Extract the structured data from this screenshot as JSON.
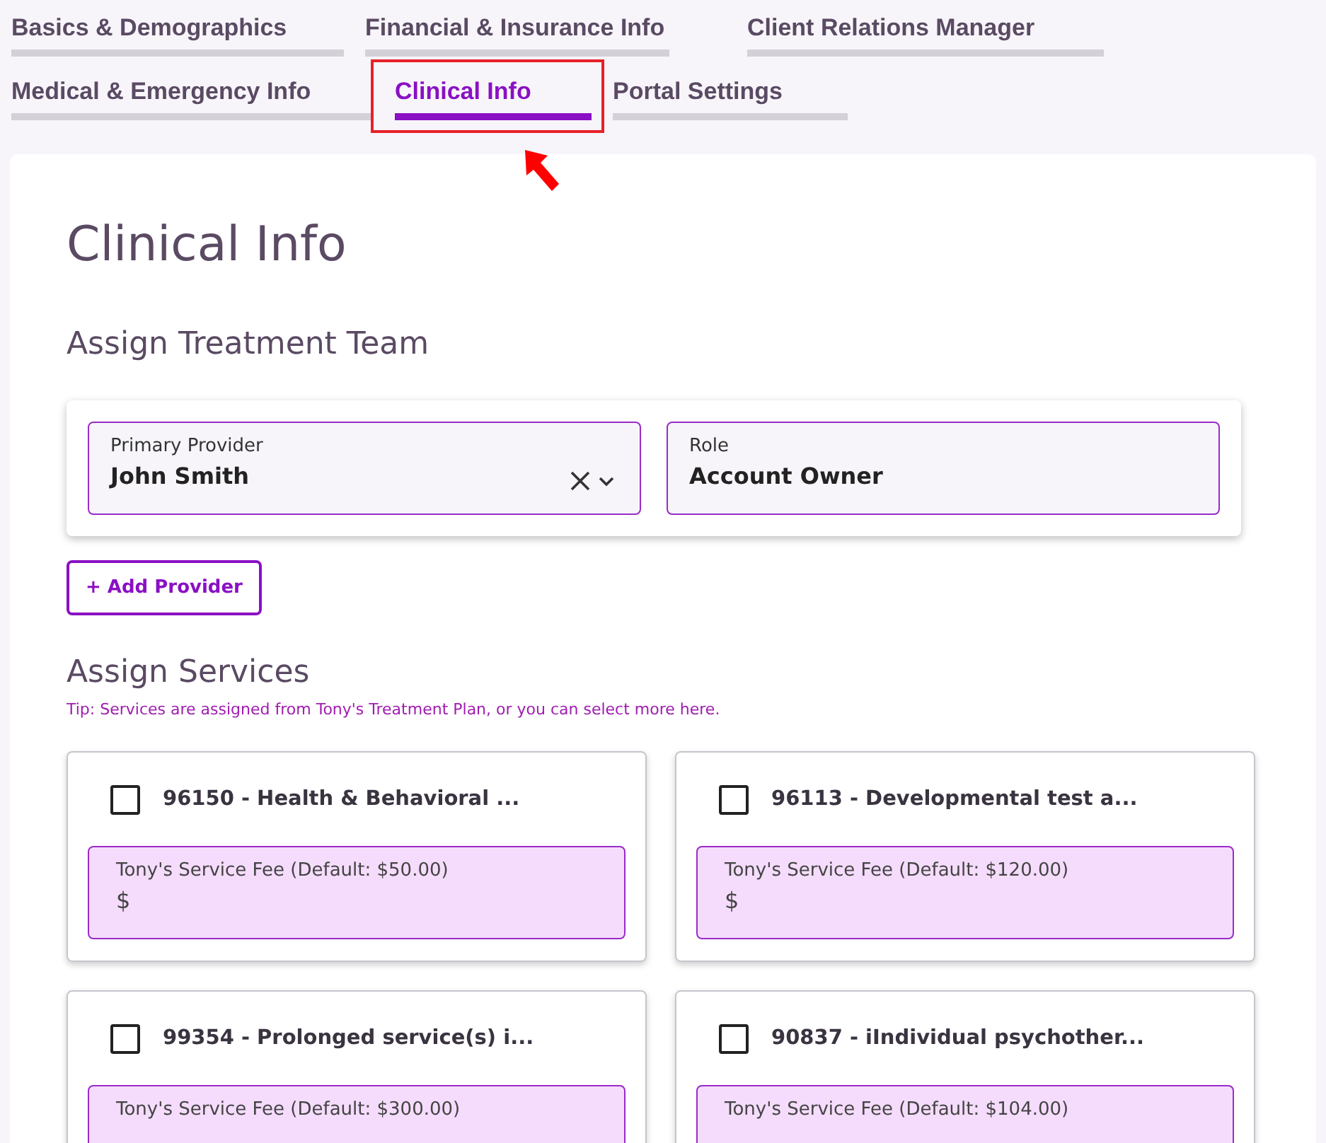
{
  "tab_rows": [
    [
      {
        "label": "Basics & Demographics",
        "selected": false
      },
      {
        "label": "Financial & Insurance Info",
        "selected": false
      },
      {
        "label": "Client Relations Manager",
        "selected": false
      }
    ],
    [
      {
        "label": "Medical & Emergency Info",
        "selected": false
      },
      {
        "label": "Clinical Info",
        "selected": true
      },
      {
        "label": "Portal Settings",
        "selected": false
      }
    ]
  ],
  "page_title": "Clinical Info",
  "treatment_team": {
    "heading": "Assign Treatment Team",
    "fields": [
      {
        "label": "Primary Provider",
        "value": "John Smith",
        "kind": "select"
      },
      {
        "label": "Role",
        "value": "Account Owner",
        "kind": "text"
      }
    ],
    "add_button": "+ Add Provider"
  },
  "services": {
    "heading": "Assign Services",
    "tip": "Tip: Services are assigned from Tony's Treatment Plan, or you can select more here.",
    "items": [
      {
        "title": "96150 - Health & Behavioral ...",
        "checked": false,
        "fee_label": "Tony's Service Fee (Default: $50.00)",
        "prefix": "$"
      },
      {
        "title": "96113 - Developmental test a...",
        "checked": false,
        "fee_label": "Tony's Service Fee (Default: $120.00)",
        "prefix": "$"
      },
      {
        "title": "99354 - Prolonged service(s) i...",
        "checked": false,
        "fee_label": "Tony's Service Fee (Default: $300.00)"
      },
      {
        "title": "90837 - iIndividual psychother...",
        "checked": false,
        "fee_label": "Tony's Service Fee (Default: $104.00)"
      }
    ]
  }
}
